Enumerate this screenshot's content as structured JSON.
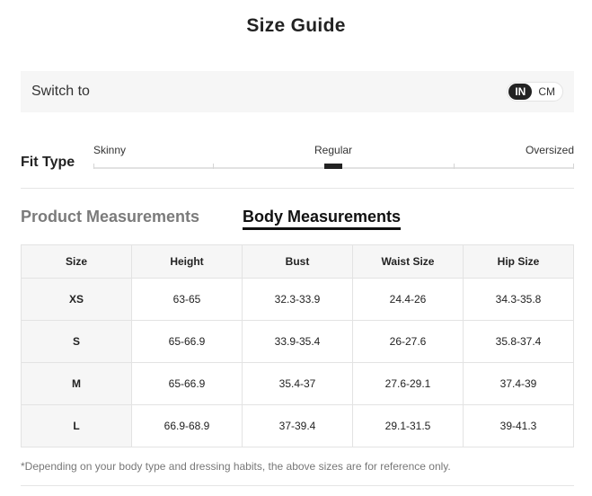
{
  "title": "Size Guide",
  "switch": {
    "label": "Switch to",
    "units": [
      "IN",
      "CM"
    ],
    "active_unit": "IN"
  },
  "fit_type": {
    "label": "Fit Type",
    "options": [
      "Skinny",
      "Regular",
      "Oversized"
    ],
    "selected": "Regular"
  },
  "tabs": [
    {
      "label": "Product Measurements",
      "active": false
    },
    {
      "label": "Body Measurements",
      "active": true
    }
  ],
  "table": {
    "headers": [
      "Size",
      "Height",
      "Bust",
      "Waist Size",
      "Hip Size"
    ],
    "rows": [
      [
        "XS",
        "63-65",
        "32.3-33.9",
        "24.4-26",
        "34.3-35.8"
      ],
      [
        "S",
        "65-66.9",
        "33.9-35.4",
        "26-27.6",
        "35.8-37.4"
      ],
      [
        "M",
        "65-66.9",
        "35.4-37",
        "27.6-29.1",
        "37.4-39"
      ],
      [
        "L",
        "66.9-68.9",
        "37-39.4",
        "29.1-31.5",
        "39-41.3"
      ]
    ]
  },
  "footnote": "*Depending on your body type and dressing habits, the above sizes are for reference only."
}
